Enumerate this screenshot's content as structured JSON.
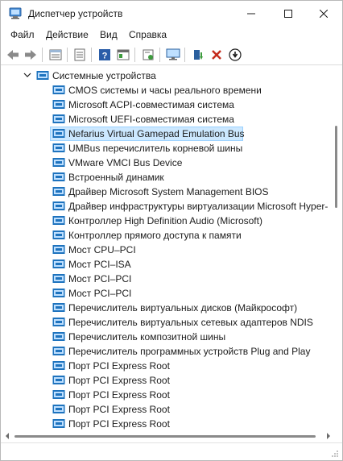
{
  "window": {
    "title": "Диспетчер устройств"
  },
  "titlebar_buttons": {
    "minimize_icon": "minimize-icon",
    "maximize_icon": "maximize-icon",
    "close_icon": "close-icon"
  },
  "menu": {
    "items": [
      "Файл",
      "Действие",
      "Вид",
      "Справка"
    ]
  },
  "toolbar": {
    "buttons": [
      "back-arrow-icon",
      "forward-arrow-icon",
      "properties-icon",
      "list-icon",
      "help-icon",
      "view-icon",
      "scan-hardware-icon",
      "monitor-icon",
      "update-driver-icon",
      "uninstall-icon",
      "disable-device-icon"
    ]
  },
  "colors": {
    "selection_fill": "#cce8ff",
    "selection_border": "#99d1ff",
    "device_icon_blue": "#1e73be",
    "uninstall_red": "#c42b1c"
  },
  "tree": {
    "category": {
      "label": "Системные устройства",
      "expanded": true
    },
    "devices": [
      {
        "label": "CMOS системы и часы реального времени",
        "selected": false
      },
      {
        "label": "Microsoft ACPI-совместимая система",
        "selected": false
      },
      {
        "label": "Microsoft UEFI-совместимая система",
        "selected": false
      },
      {
        "label": "Nefarius Virtual Gamepad Emulation Bus",
        "selected": true
      },
      {
        "label": "UMBus перечислитель корневой шины",
        "selected": false
      },
      {
        "label": "VMware VMCI Bus Device",
        "selected": false
      },
      {
        "label": "Встроенный динамик",
        "selected": false
      },
      {
        "label": "Драйвер Microsoft System Management BIOS",
        "selected": false
      },
      {
        "label": "Драйвер инфраструктуры виртуализации Microsoft Hyper-",
        "selected": false
      },
      {
        "label": "Контроллер High Definition Audio (Microsoft)",
        "selected": false
      },
      {
        "label": "Контроллер прямого доступа к памяти",
        "selected": false
      },
      {
        "label": "Мост CPU–PCI",
        "selected": false
      },
      {
        "label": "Мост PCI–ISA",
        "selected": false
      },
      {
        "label": "Мост PCI–PCI",
        "selected": false
      },
      {
        "label": "Мост PCI–PCI",
        "selected": false
      },
      {
        "label": "Перечислитель виртуальных дисков (Майкрософт)",
        "selected": false
      },
      {
        "label": "Перечислитель виртуальных сетевых адаптеров NDIS",
        "selected": false
      },
      {
        "label": "Перечислитель композитной шины",
        "selected": false
      },
      {
        "label": "Перечислитель программных устройств Plug and Play",
        "selected": false
      },
      {
        "label": "Порт PCI Express Root",
        "selected": false
      },
      {
        "label": "Порт PCI Express Root",
        "selected": false
      },
      {
        "label": "Порт PCI Express Root",
        "selected": false
      },
      {
        "label": "Порт PCI Express Root",
        "selected": false
      },
      {
        "label": "Порт PCI Express Root",
        "selected": false
      }
    ]
  },
  "scrollbars": {
    "vertical_position_fraction": 0.17,
    "horizontal_position_fraction": 0.0
  }
}
